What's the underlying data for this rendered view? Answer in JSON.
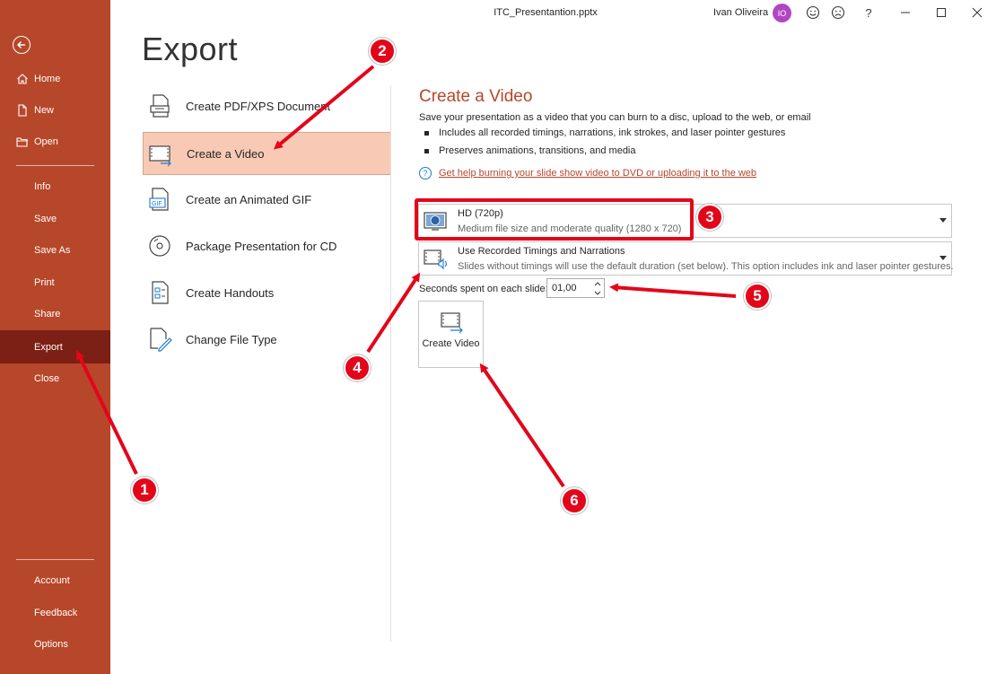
{
  "window": {
    "doc_title": "ITC_Presentantion.pptx",
    "user_name": "Ivan Oliveira",
    "avatar_initials": "IO",
    "help_glyph": "?"
  },
  "sidebar": {
    "back_icon": "back-arrow-icon",
    "items_top": [
      {
        "label": "Home",
        "icon": "home-icon"
      },
      {
        "label": "New",
        "icon": "new-document-icon"
      },
      {
        "label": "Open",
        "icon": "open-folder-icon"
      }
    ],
    "items_mid": [
      {
        "label": "Info"
      },
      {
        "label": "Save"
      },
      {
        "label": "Save As"
      },
      {
        "label": "Print"
      },
      {
        "label": "Share"
      },
      {
        "label": "Export",
        "active": true
      },
      {
        "label": "Close"
      }
    ],
    "items_bottom": [
      {
        "label": "Account"
      },
      {
        "label": "Feedback"
      },
      {
        "label": "Options"
      }
    ]
  },
  "export": {
    "heading": "Export",
    "options": [
      {
        "label": "Create PDF/XPS Document",
        "icon": "pdf-document-icon"
      },
      {
        "label": "Create a Video",
        "icon": "video-icon",
        "selected": true
      },
      {
        "label": "Create an Animated GIF",
        "icon": "gif-icon"
      },
      {
        "label": "Package Presentation for CD",
        "icon": "cd-icon"
      },
      {
        "label": "Create Handouts",
        "icon": "handouts-icon"
      },
      {
        "label": "Change File Type",
        "icon": "change-file-type-icon"
      }
    ]
  },
  "video": {
    "title": "Create a Video",
    "description": "Save your presentation as a video that you can burn to a disc, upload to the web, or email",
    "bullets": [
      "Includes all recorded timings, narrations, ink strokes, and laser pointer gestures",
      "Preserves animations, transitions, and media"
    ],
    "help_link": "Get help burning your slide show video to DVD or uploading it to the web",
    "quality": {
      "title": "HD (720p)",
      "subtitle": "Medium file size and moderate quality (1280 x 720)"
    },
    "timings": {
      "title": "Use Recorded Timings and Narrations",
      "subtitle": "Slides without timings will use the default duration (set below). This option includes ink and laser pointer gestures."
    },
    "seconds_label": "Seconds spent on each slide:",
    "seconds_value": "01,00",
    "create_button": "Create Video"
  },
  "annotations": {
    "color": "#e3061a",
    "numbers": [
      "1",
      "2",
      "3",
      "4",
      "5",
      "6"
    ]
  },
  "colors": {
    "accent": "#b7472a",
    "active_nav": "#7c1f14",
    "selected_option": "#f8cab5"
  }
}
